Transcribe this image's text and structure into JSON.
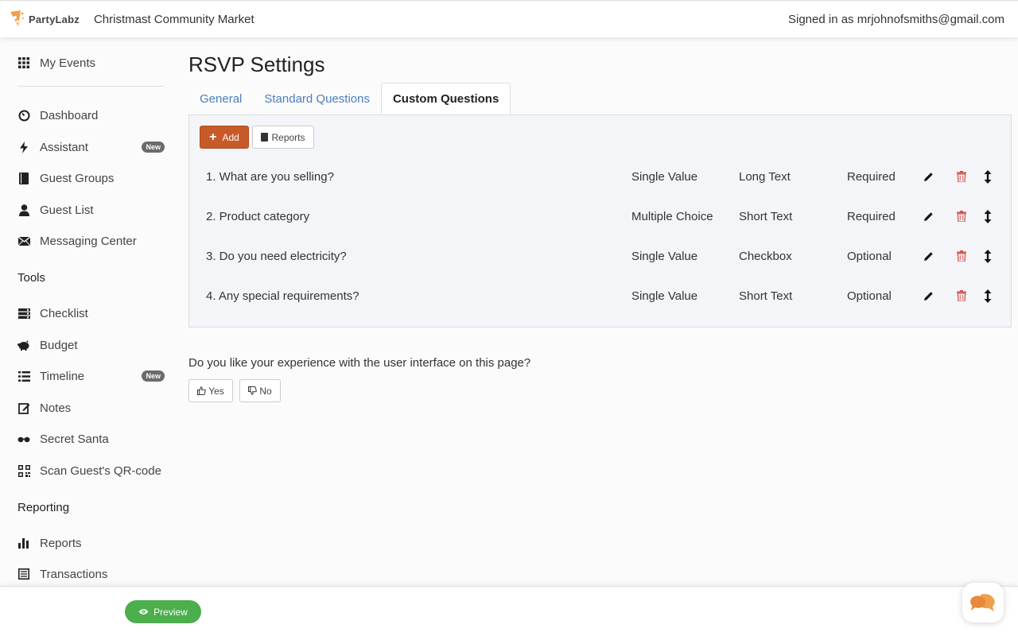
{
  "header": {
    "logo_text": "PartyLabz",
    "event_name": "Christmast Community Market",
    "signed_in": "Signed in as mrjohnofsmiths@gmail.com"
  },
  "sidebar": {
    "my_events": "My Events",
    "items": [
      {
        "label": "Dashboard",
        "icon": "dashboard-icon"
      },
      {
        "label": "Assistant",
        "icon": "bolt-icon",
        "badge": "New"
      },
      {
        "label": "Guest Groups",
        "icon": "book-icon"
      },
      {
        "label": "Guest List",
        "icon": "user-icon"
      },
      {
        "label": "Messaging Center",
        "icon": "envelope-icon"
      }
    ],
    "tools_title": "Tools",
    "tools": [
      {
        "label": "Checklist",
        "icon": "checklist-icon"
      },
      {
        "label": "Budget",
        "icon": "piggy-bank-icon"
      },
      {
        "label": "Timeline",
        "icon": "list-icon",
        "badge": "New"
      },
      {
        "label": "Notes",
        "icon": "edit-icon"
      },
      {
        "label": "Secret Santa",
        "icon": "sunglasses-icon"
      },
      {
        "label": "Scan Guest's QR-code",
        "icon": "qrcode-icon"
      }
    ],
    "reporting_title": "Reporting",
    "reporting": [
      {
        "label": "Reports",
        "icon": "bar-chart-icon"
      },
      {
        "label": "Transactions",
        "icon": "ledger-icon"
      }
    ]
  },
  "main": {
    "title": "RSVP Settings",
    "tabs": [
      {
        "label": "General",
        "active": false
      },
      {
        "label": "Standard Questions",
        "active": false
      },
      {
        "label": "Custom Questions",
        "active": true
      }
    ],
    "add_label": "Add",
    "reports_label": "Reports",
    "questions": [
      {
        "title": "1. What are you selling?",
        "mode": "Single Value",
        "type": "Long Text",
        "required": "Required"
      },
      {
        "title": "2. Product category",
        "mode": "Multiple Choice",
        "type": "Short Text",
        "required": "Required"
      },
      {
        "title": "3. Do you need electricity?",
        "mode": "Single Value",
        "type": "Checkbox",
        "required": "Optional"
      },
      {
        "title": "4. Any special requirements?",
        "mode": "Single Value",
        "type": "Short Text",
        "required": "Optional"
      }
    ],
    "feedback_question": "Do you like your experience with the user interface on this page?",
    "yes_label": "Yes",
    "no_label": "No"
  },
  "footer": {
    "preview_label": "Preview"
  },
  "colors": {
    "accent": "#c75a29",
    "link": "#4a7fc1",
    "delete": "#d9534f",
    "preview": "#4cae4c",
    "chat": "#f0a04b"
  }
}
